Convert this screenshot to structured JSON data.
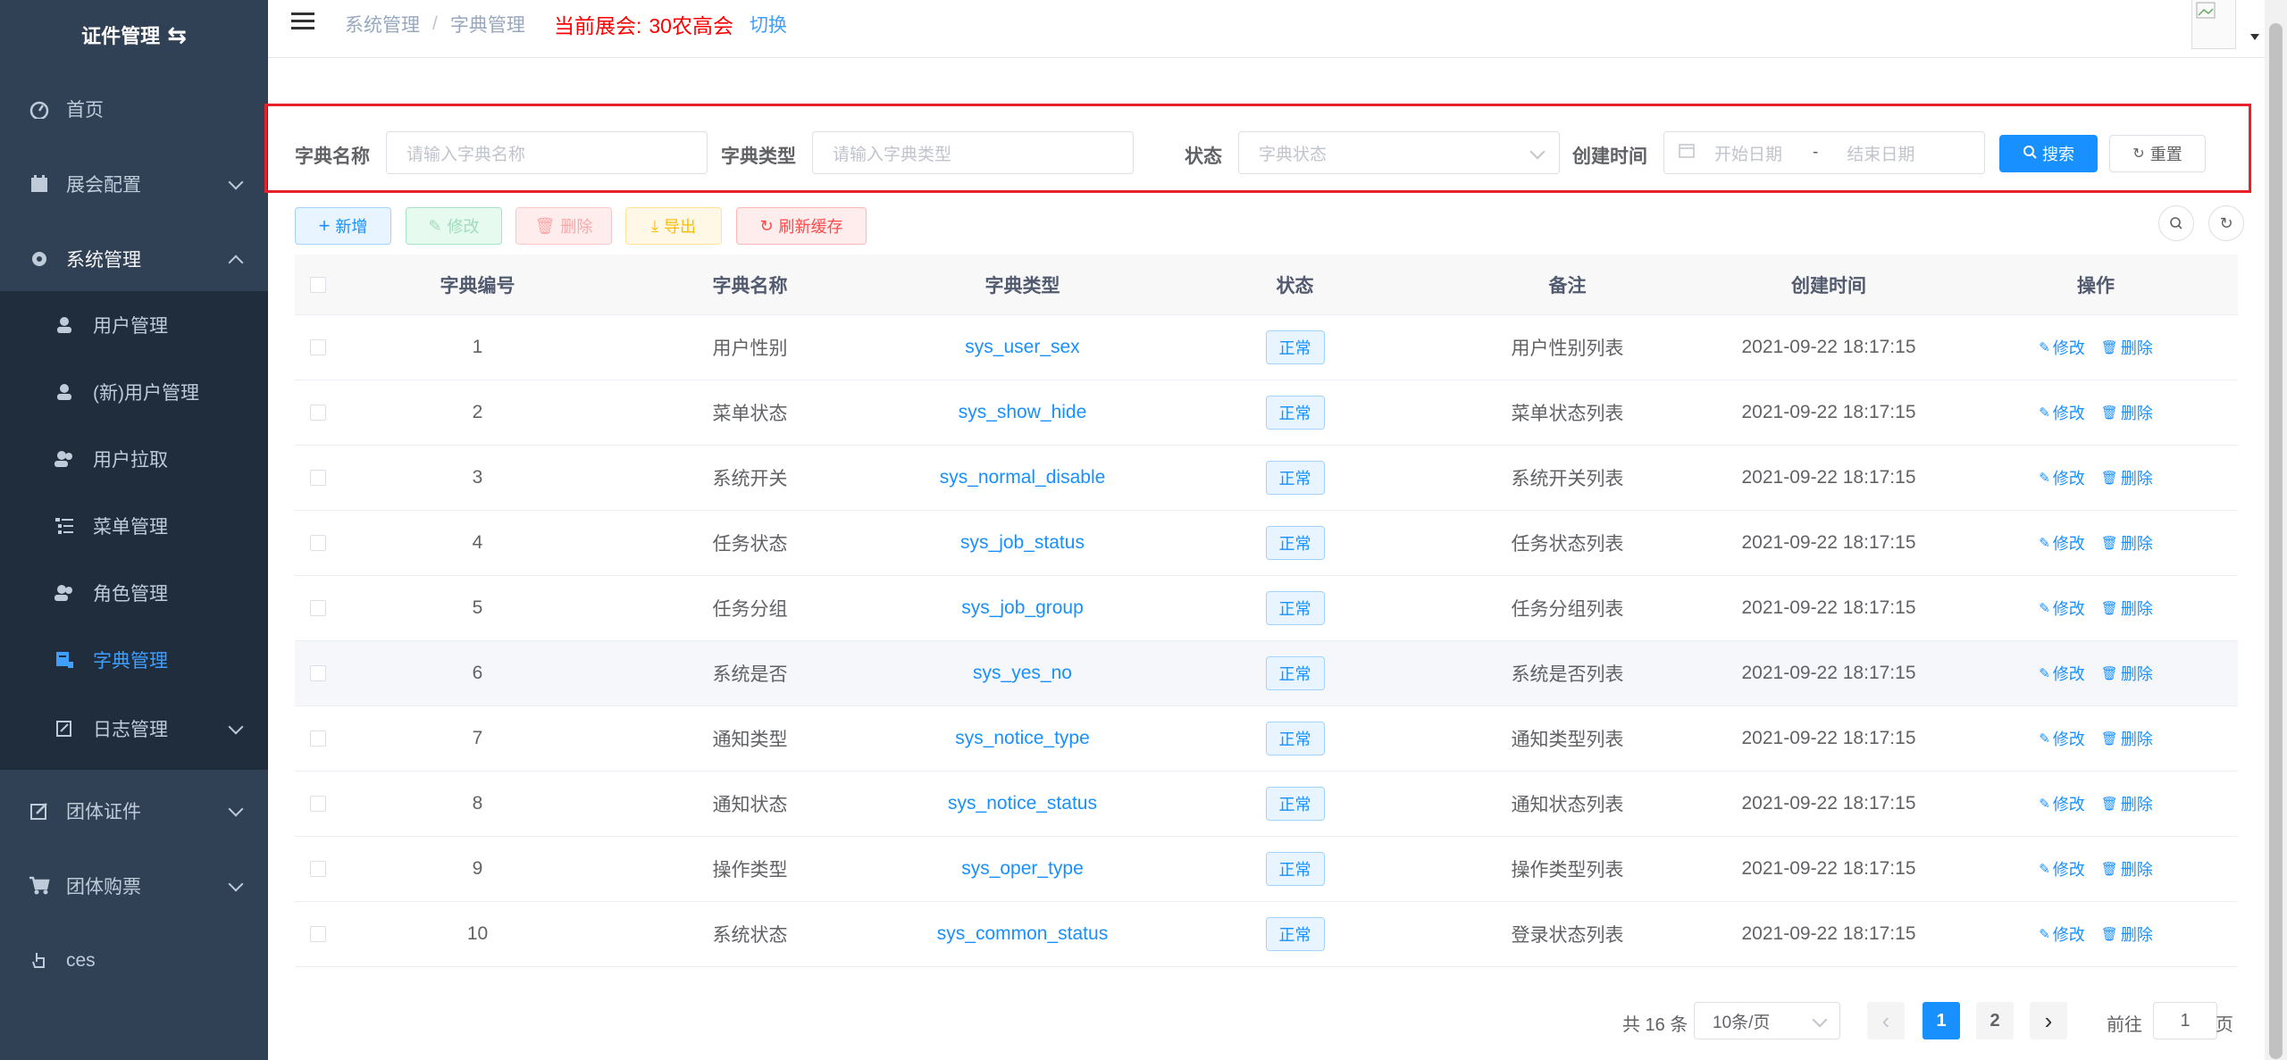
{
  "sidebar": {
    "title": "证件管理",
    "items": [
      {
        "label": "首页"
      },
      {
        "label": "展会配置"
      },
      {
        "label": "系统管理"
      },
      {
        "label": "团体证件"
      },
      {
        "label": "团体购票"
      },
      {
        "label": "ces"
      }
    ],
    "submenu": [
      {
        "label": "用户管理"
      },
      {
        "label": "(新)用户管理"
      },
      {
        "label": "用户拉取"
      },
      {
        "label": "菜单管理"
      },
      {
        "label": "角色管理"
      },
      {
        "label": "字典管理"
      },
      {
        "label": "日志管理"
      }
    ],
    "active_color": "#409eff",
    "bg_color": "#304156"
  },
  "header": {
    "breadcrumb": [
      "系统管理",
      "字典管理"
    ],
    "breadcrumb_sep": "/",
    "current_expo_label": "当前展会:",
    "current_expo_value": "30农高会",
    "switch_label": "切换"
  },
  "search": {
    "dict_name_label": "字典名称",
    "dict_name_placeholder": "请输入字典名称",
    "dict_type_label": "字典类型",
    "dict_type_placeholder": "请输入字典类型",
    "status_label": "状态",
    "status_placeholder": "字典状态",
    "created_label": "创建时间",
    "start_placeholder": "开始日期",
    "range_sep": "-",
    "end_placeholder": "结束日期",
    "search_button": "搜索",
    "reset_button": "重置"
  },
  "toolbar": {
    "add": "新增",
    "edit": "修改",
    "delete": "删除",
    "export": "导出",
    "refresh_cache": "刷新缓存"
  },
  "table": {
    "columns": [
      "字典编号",
      "字典名称",
      "字典类型",
      "状态",
      "备注",
      "创建时间",
      "操作"
    ],
    "edit_label": "修改",
    "delete_label": "删除",
    "rows": [
      {
        "id": "1",
        "name": "用户性别",
        "type": "sys_user_sex",
        "status": "正常",
        "remark": "用户性别列表",
        "created": "2021-09-22 18:17:15"
      },
      {
        "id": "2",
        "name": "菜单状态",
        "type": "sys_show_hide",
        "status": "正常",
        "remark": "菜单状态列表",
        "created": "2021-09-22 18:17:15"
      },
      {
        "id": "3",
        "name": "系统开关",
        "type": "sys_normal_disable",
        "status": "正常",
        "remark": "系统开关列表",
        "created": "2021-09-22 18:17:15"
      },
      {
        "id": "4",
        "name": "任务状态",
        "type": "sys_job_status",
        "status": "正常",
        "remark": "任务状态列表",
        "created": "2021-09-22 18:17:15"
      },
      {
        "id": "5",
        "name": "任务分组",
        "type": "sys_job_group",
        "status": "正常",
        "remark": "任务分组列表",
        "created": "2021-09-22 18:17:15"
      },
      {
        "id": "6",
        "name": "系统是否",
        "type": "sys_yes_no",
        "status": "正常",
        "remark": "系统是否列表",
        "created": "2021-09-22 18:17:15"
      },
      {
        "id": "7",
        "name": "通知类型",
        "type": "sys_notice_type",
        "status": "正常",
        "remark": "通知类型列表",
        "created": "2021-09-22 18:17:15"
      },
      {
        "id": "8",
        "name": "通知状态",
        "type": "sys_notice_status",
        "status": "正常",
        "remark": "通知状态列表",
        "created": "2021-09-22 18:17:15"
      },
      {
        "id": "9",
        "name": "操作类型",
        "type": "sys_oper_type",
        "status": "正常",
        "remark": "操作类型列表",
        "created": "2021-09-22 18:17:15"
      },
      {
        "id": "10",
        "name": "系统状态",
        "type": "sys_common_status",
        "status": "正常",
        "remark": "登录状态列表",
        "created": "2021-09-22 18:17:15"
      }
    ]
  },
  "pagination": {
    "total_text": "共 16 条",
    "page_size": "10条/页",
    "pages": [
      "1",
      "2"
    ],
    "current_page": "1",
    "goto_label": "前往",
    "goto_value": "1",
    "page_suffix": "页"
  }
}
